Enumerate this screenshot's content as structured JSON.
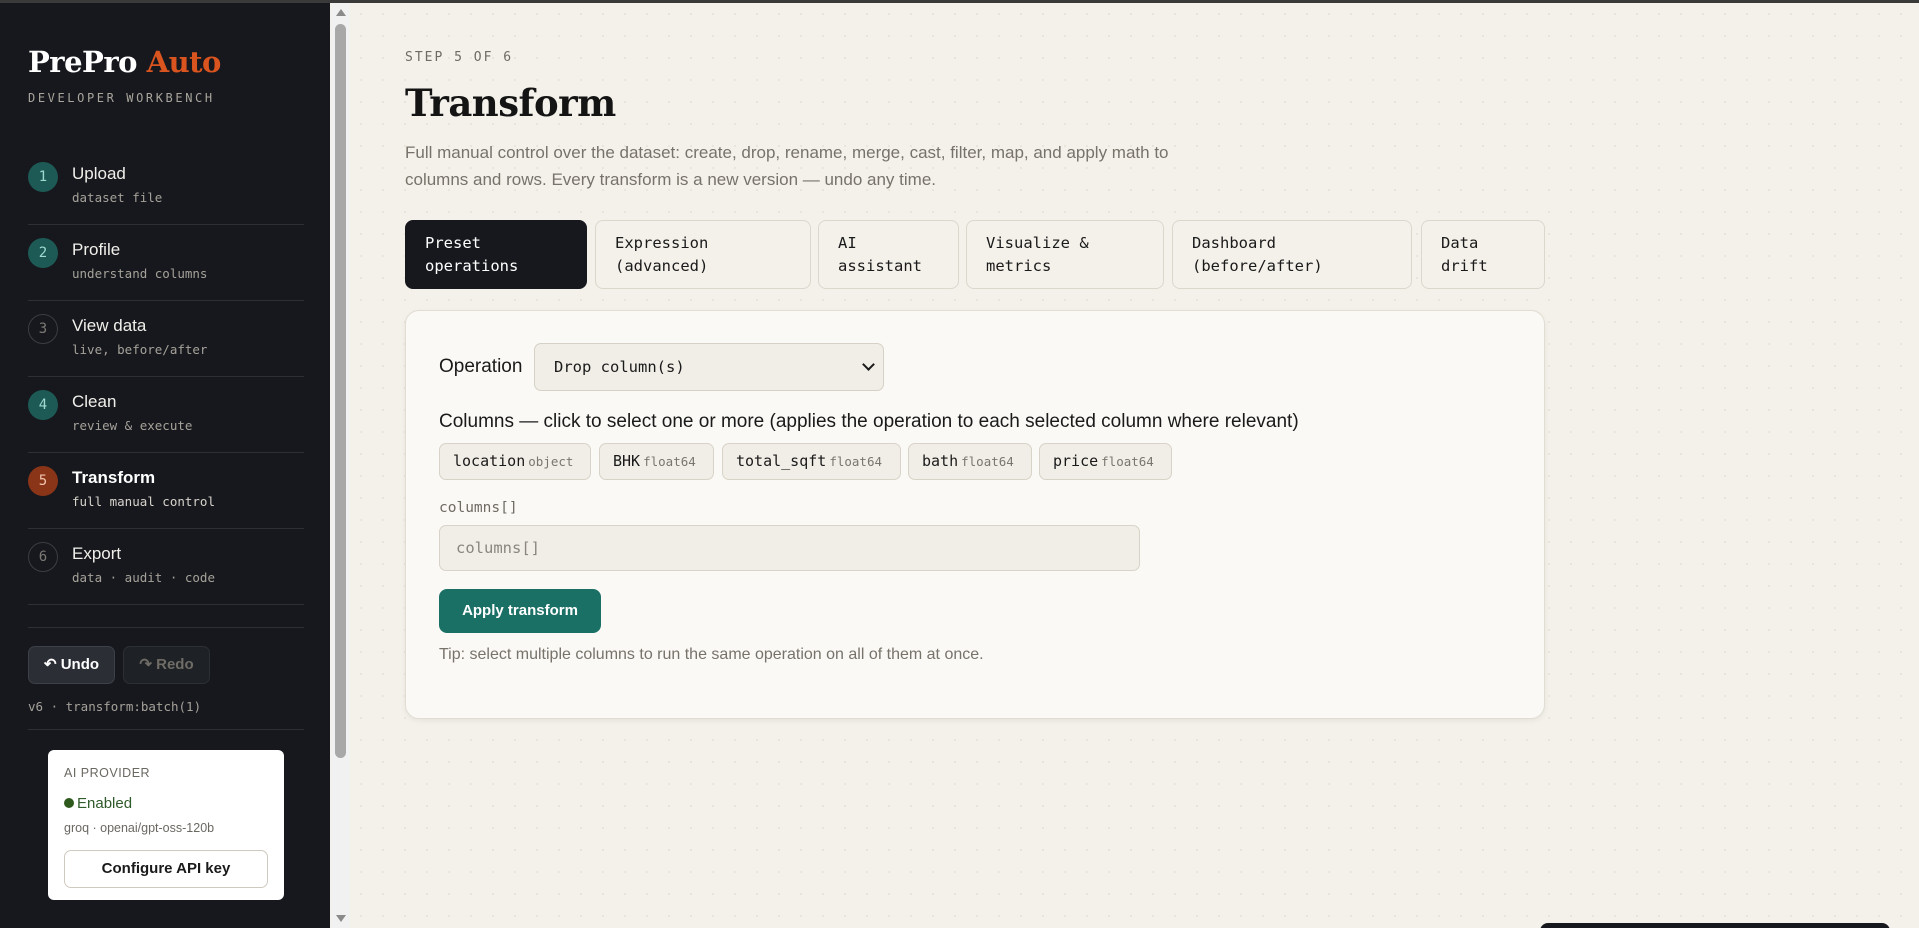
{
  "brand": {
    "name": "PrePro",
    "accent": "Auto",
    "subtitle": "DEVELOPER WORKBENCH"
  },
  "steps": [
    {
      "num": "1",
      "title": "Upload",
      "sub": "dataset file",
      "state": "done"
    },
    {
      "num": "2",
      "title": "Profile",
      "sub": "understand columns",
      "state": "done"
    },
    {
      "num": "3",
      "title": "View data",
      "sub": "live, before/after",
      "state": "pending"
    },
    {
      "num": "4",
      "title": "Clean",
      "sub": "review & execute",
      "state": "done"
    },
    {
      "num": "5",
      "title": "Transform",
      "sub": "full manual control",
      "state": "active"
    },
    {
      "num": "6",
      "title": "Export",
      "sub": "data · audit · code",
      "state": "pending"
    }
  ],
  "history": {
    "undo_label": "↶ Undo",
    "redo_label": "↷ Redo",
    "version": "v6 · transform:batch(1)"
  },
  "ai_provider": {
    "label": "AI PROVIDER",
    "status": "Enabled",
    "model": "groq · openai/gpt-oss-120b",
    "configure_label": "Configure API key"
  },
  "main": {
    "step_label": "STEP 5 OF 6",
    "title": "Transform",
    "description": "Full manual control over the dataset: create, drop, rename, merge, cast, filter, map, and apply math to columns and rows. Every transform is a new version — undo any time."
  },
  "tabs": [
    {
      "line1": "Preset",
      "line2": "operations",
      "active": true
    },
    {
      "line1": "Expression",
      "line2": "(advanced)",
      "active": false
    },
    {
      "line1": "AI",
      "line2": "assistant",
      "active": false
    },
    {
      "line1": "Visualize &",
      "line2": "metrics",
      "active": false
    },
    {
      "line1": "Dashboard",
      "line2": "(before/after)",
      "active": false
    },
    {
      "line1": "Data",
      "line2": "drift",
      "active": false
    }
  ],
  "operation": {
    "label": "Operation",
    "selected": "Drop column(s)"
  },
  "columns": {
    "label": "Columns — click to select one or more (applies the operation to each selected column where relevant)",
    "items": [
      {
        "name": "location",
        "type": "object"
      },
      {
        "name": "BHK",
        "type": "float64"
      },
      {
        "name": "total_sqft",
        "type": "float64"
      },
      {
        "name": "bath",
        "type": "float64"
      },
      {
        "name": "price",
        "type": "float64"
      }
    ]
  },
  "field": {
    "label": "columns[]",
    "placeholder": "columns[]"
  },
  "apply_label": "Apply transform",
  "tip": "Tip: select multiple columns to run the same operation on all of them at once.",
  "colors": {
    "accent": "#d9541e",
    "primary_button": "#1b7066",
    "sidebar_bg": "#16181d"
  }
}
